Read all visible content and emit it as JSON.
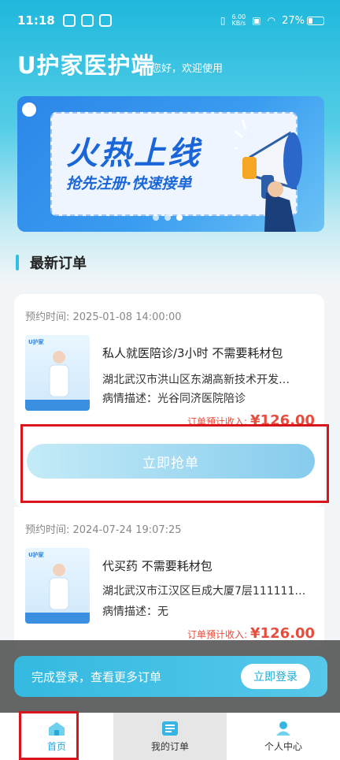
{
  "status_bar": {
    "time": "11:18",
    "net_speed_top": "6.00",
    "net_speed_bottom": "KB/s",
    "battery": "27%"
  },
  "header": {
    "title": "U护家医护端",
    "subtitle": "您好，欢迎使用"
  },
  "banner": {
    "headline": "火热上线",
    "slogan": "抢先注册·快速接单"
  },
  "section": {
    "title": "最新订单"
  },
  "orders": [
    {
      "time_label": "预约时间: 2025-01-08 14:00:00",
      "title": "私人就医陪诊/3小时 不需要耗材包",
      "address": "湖北武汉市洪山区东湖高新技术开发…",
      "description": "病情描述：光谷同济医院陪诊",
      "income_label": "订单预计收入:",
      "income_amount": "¥126.00",
      "button": "立即抢单",
      "thumb_brand": "U护家"
    },
    {
      "time_label": "预约时间: 2024-07-24 19:07:25",
      "title": "代买药 不需要耗材包",
      "address": "湖北武汉市江汉区巨成大厦7层111111…",
      "description": "病情描述：无",
      "income_label": "订单预计收入:",
      "income_amount": "¥126.00",
      "thumb_brand": "U护家"
    }
  ],
  "login_prompt": {
    "message": "完成登录，查看更多订单",
    "button": "立即登录"
  },
  "tabbar": {
    "home": "首页",
    "my_orders": "我的订单",
    "profile": "个人中心"
  },
  "colors": {
    "accent": "#1fa8d6",
    "price": "#e74c3c",
    "annotation": "#d9151b"
  }
}
